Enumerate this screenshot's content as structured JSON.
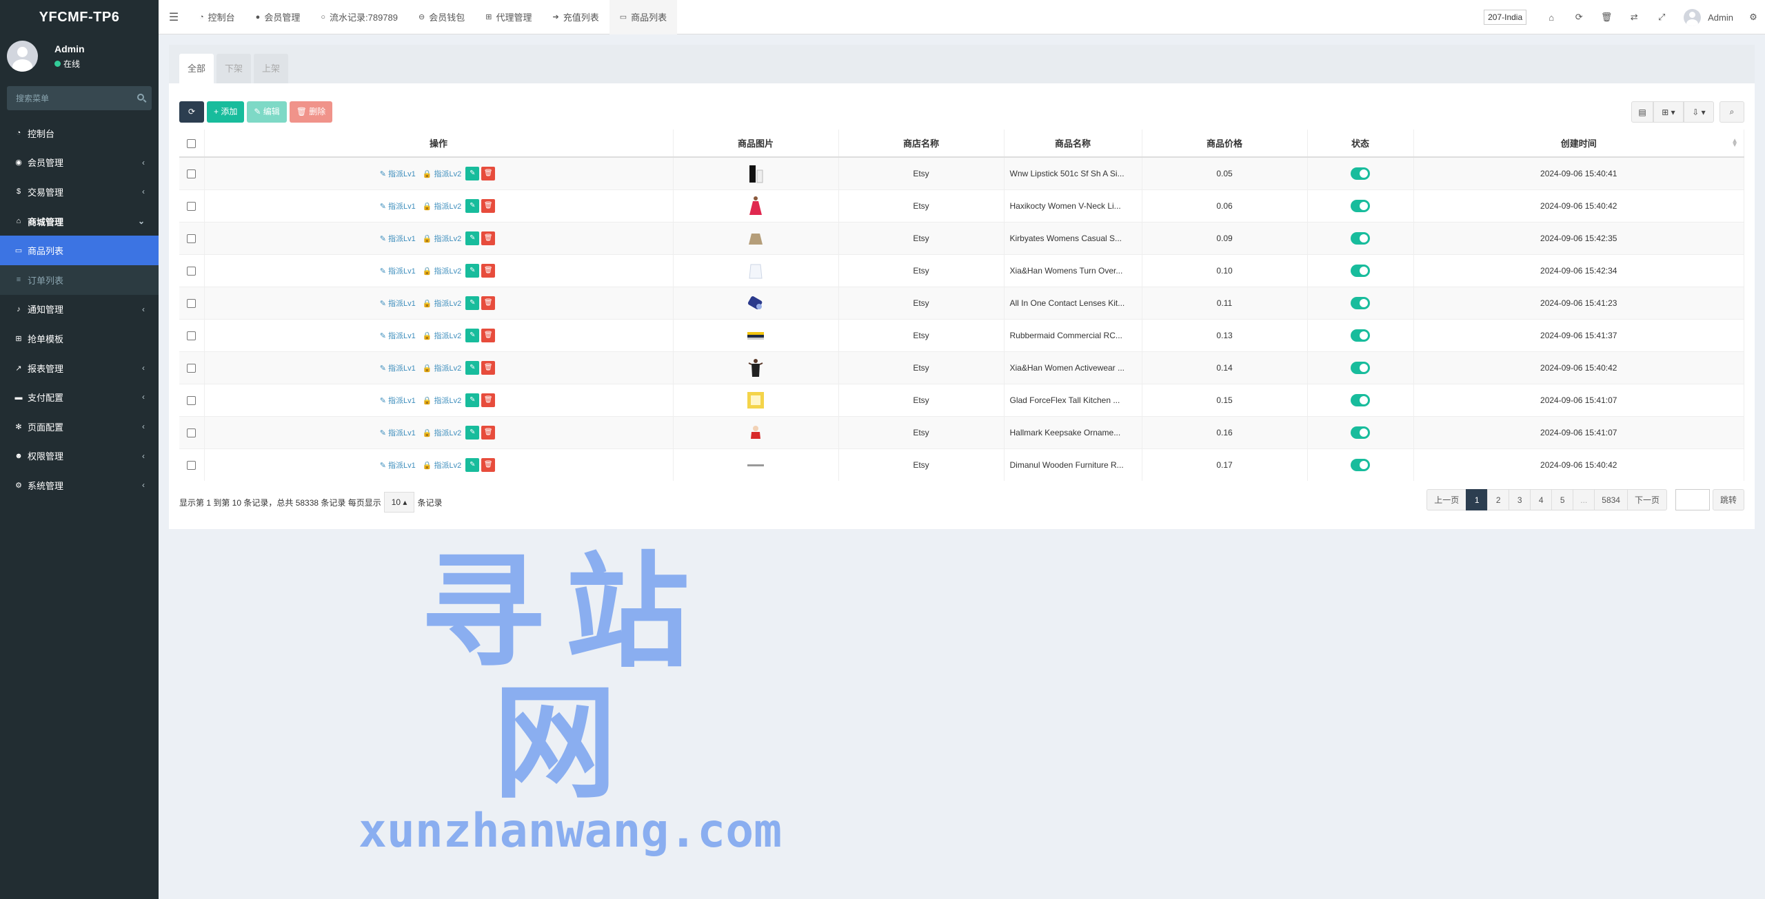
{
  "app": {
    "title": "YFCMF-TP6"
  },
  "user": {
    "name": "Admin",
    "status": "在线"
  },
  "sidebar": {
    "search_placeholder": "搜索菜单",
    "items": [
      {
        "label": "控制台",
        "icon": "dashboard-icon",
        "glyph": "◔",
        "arrow": ""
      },
      {
        "label": "会员管理",
        "icon": "user-circle-icon",
        "glyph": "◉",
        "arrow": "‹"
      },
      {
        "label": "交易管理",
        "icon": "dollar-icon",
        "glyph": "$",
        "arrow": "‹"
      },
      {
        "label": "商城管理",
        "icon": "home-icon",
        "glyph": "⌂",
        "arrow": "⌄"
      },
      {
        "label": "商品列表",
        "icon": "monitor-icon",
        "glyph": "▭",
        "arrow": ""
      },
      {
        "label": "订单列表",
        "icon": "list-icon",
        "glyph": "≡",
        "arrow": ""
      },
      {
        "label": "通知管理",
        "icon": "bell-icon",
        "glyph": "♪",
        "arrow": "‹"
      },
      {
        "label": "抢单模板",
        "icon": "sitemap-icon",
        "glyph": "⊞",
        "arrow": ""
      },
      {
        "label": "报表管理",
        "icon": "line-chart-icon",
        "glyph": "↗",
        "arrow": "‹"
      },
      {
        "label": "支付配置",
        "icon": "credit-card-icon",
        "glyph": "▬",
        "arrow": "‹"
      },
      {
        "label": "页面配置",
        "icon": "cog-icon",
        "glyph": "✻",
        "arrow": "‹"
      },
      {
        "label": "权限管理",
        "icon": "users-icon",
        "glyph": "☻",
        "arrow": "‹"
      },
      {
        "label": "系统管理",
        "icon": "cogs-icon",
        "glyph": "⚙",
        "arrow": "‹"
      }
    ]
  },
  "topnav": {
    "tabs": [
      {
        "label": "控制台",
        "icon": "dashboard-icon",
        "glyph": "◔"
      },
      {
        "label": "会员管理",
        "icon": "user-icon",
        "glyph": "●"
      },
      {
        "label": "流水记录:789789",
        "icon": "circle-icon",
        "glyph": "○"
      },
      {
        "label": "会员钱包",
        "icon": "wallet-icon",
        "glyph": "⊖"
      },
      {
        "label": "代理管理",
        "icon": "sitemap-icon",
        "glyph": "⊞"
      },
      {
        "label": "充值列表",
        "icon": "sign-in-icon",
        "glyph": "➔"
      },
      {
        "label": "商品列表",
        "icon": "monitor-icon",
        "glyph": "▭"
      }
    ],
    "lang": "207-India",
    "username": "Admin"
  },
  "panel": {
    "tabs": [
      "全部",
      "下架",
      "上架"
    ],
    "toolbar": {
      "add": "+ 添加",
      "edit": "✎ 编辑",
      "delete": "🗑 删除"
    }
  },
  "table": {
    "headers": [
      "操作",
      "商品图片",
      "商店名称",
      "商品名称",
      "商品价格",
      "状态",
      "创建时间"
    ],
    "op_lv1": "指派Lv1",
    "op_lv2": "指派Lv2",
    "rows": [
      {
        "shop": "Etsy",
        "name": "Wnw Lipstick 501c Sf Sh A Si...",
        "price": "0.05",
        "created": "2024-09-06 15:40:41",
        "img": "lipstick"
      },
      {
        "shop": "Etsy",
        "name": "Haxikocty Women V-Neck Li...",
        "price": "0.06",
        "created": "2024-09-06 15:40:42",
        "img": "dress"
      },
      {
        "shop": "Etsy",
        "name": "Kirbyates Womens Casual S...",
        "price": "0.09",
        "created": "2024-09-06 15:42:35",
        "img": "skirt"
      },
      {
        "shop": "Etsy",
        "name": "Xia&Han Womens Turn Over...",
        "price": "0.10",
        "created": "2024-09-06 15:42:34",
        "img": "shirt"
      },
      {
        "shop": "Etsy",
        "name": "All In One Contact Lenses Kit...",
        "price": "0.11",
        "created": "2024-09-06 15:41:23",
        "img": "lenses"
      },
      {
        "shop": "Etsy",
        "name": "Rubbermaid Commercial RC...",
        "price": "0.13",
        "created": "2024-09-06 15:41:37",
        "img": "box"
      },
      {
        "shop": "Etsy",
        "name": "Xia&Han Women Activewear ...",
        "price": "0.14",
        "created": "2024-09-06 15:40:42",
        "img": "activewear"
      },
      {
        "shop": "Etsy",
        "name": "Glad ForceFlex Tall Kitchen ...",
        "price": "0.15",
        "created": "2024-09-06 15:41:07",
        "img": "bags"
      },
      {
        "shop": "Etsy",
        "name": "Hallmark Keepsake Orname...",
        "price": "0.16",
        "created": "2024-09-06 15:41:07",
        "img": "ornament"
      },
      {
        "shop": "Etsy",
        "name": "Dimanul Wooden Furniture R...",
        "price": "0.17",
        "created": "2024-09-06 15:40:42",
        "img": "rail"
      }
    ]
  },
  "footer": {
    "info": "显示第 1 到第 10 条记录，总共 58338 条记录 每页显示",
    "page_size": "10",
    "suffix": "条记录"
  },
  "pager": {
    "prev": "上一页",
    "pages": [
      "1",
      "2",
      "3",
      "4",
      "5",
      "...",
      "5834"
    ],
    "next": "下一页",
    "jump": "跳转"
  },
  "watermark": {
    "cn": "寻站网",
    "en": "xunzhanwang.com"
  },
  "colors": {
    "sidebar": "#222d32",
    "active": "#3c74e3",
    "green": "#18bc9c",
    "red": "#e74c3c",
    "dark": "#2c3e50"
  }
}
